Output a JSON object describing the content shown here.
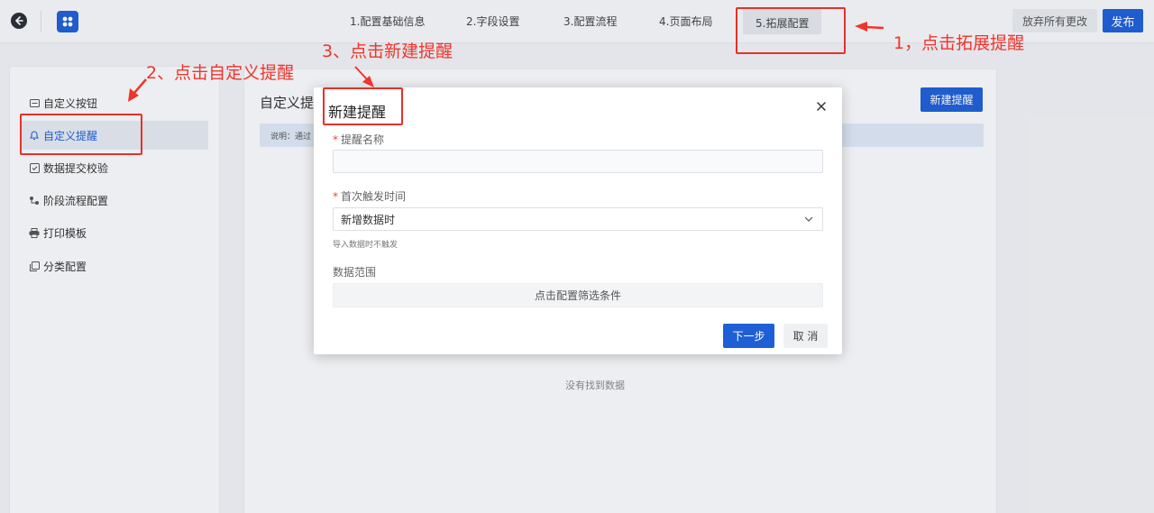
{
  "header": {
    "steps": [
      {
        "label": "1.配置基础信息"
      },
      {
        "label": "2.字段设置"
      },
      {
        "label": "3.配置流程"
      },
      {
        "label": "4.页面布局"
      },
      {
        "label": "5.拓展配置"
      }
    ],
    "active_step": 4,
    "discard_label": "放弃所有更改",
    "publish_label": "发布"
  },
  "sidebar": {
    "items": [
      {
        "label": "自定义按钮",
        "icon": "button-icon"
      },
      {
        "label": "自定义提醒",
        "icon": "bell-icon"
      },
      {
        "label": "数据提交校验",
        "icon": "check-square-icon"
      },
      {
        "label": "阶段流程配置",
        "icon": "flow-icon"
      },
      {
        "label": "打印模板",
        "icon": "printer-icon"
      },
      {
        "label": "分类配置",
        "icon": "copy-icon"
      }
    ],
    "active_item": 1
  },
  "main": {
    "title": "自定义提",
    "new_reminder_label": "新建提醒",
    "info_text": "说明：通过",
    "empty_text": "没有找到数据"
  },
  "modal": {
    "title": "新建提醒",
    "name_label": "提醒名称",
    "name_value": "",
    "trigger_label": "首次触发时间",
    "trigger_value": "新增数据时",
    "trigger_hint": "导入数据时不触发",
    "scope_label": "数据范围",
    "filter_label": "点击配置筛选条件",
    "next_label": "下一步",
    "cancel_label": "取 消"
  },
  "annotations": {
    "step1": "1，点击拓展提醒",
    "step2": "2、点击自定义提醒",
    "step3": "3、点击新建提醒"
  },
  "colors": {
    "primary": "#1f5fd6",
    "annotation_red": "#e5322a",
    "required": "#e5493b"
  }
}
